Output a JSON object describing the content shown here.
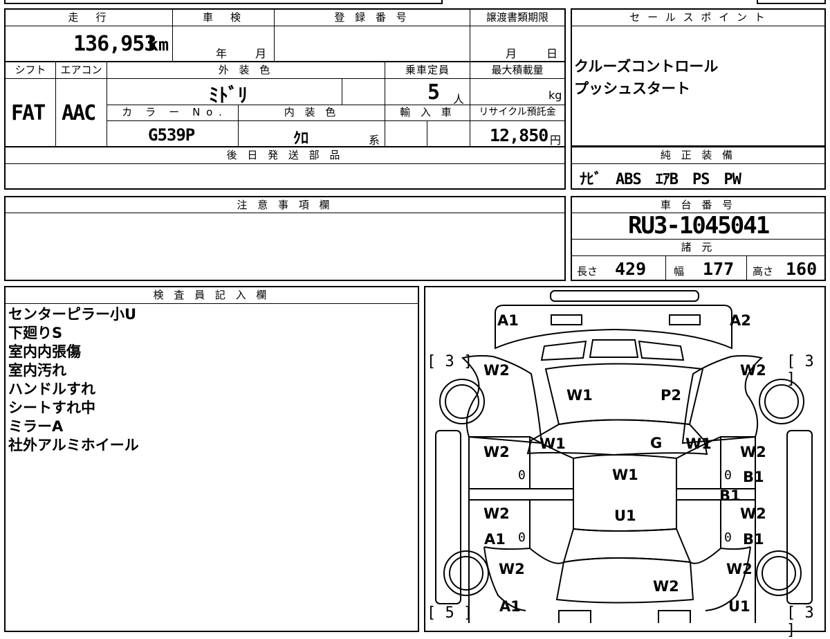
{
  "left_table": {
    "headers": {
      "mileage": "走　行",
      "inspection": "車　検",
      "registration_number": "登 録 番 号",
      "transfer_deadline": "譲渡書類期限",
      "shift": "シフト",
      "aircon": "エアコン",
      "exterior_color": "外 装 色",
      "capacity": "乗車定員",
      "max_load": "最大積載量",
      "color_no": "カ　ラ　ー　N o .",
      "interior_color": "内 装 色",
      "import": "輸 入 車",
      "recycle_fee": "リサイクル預託金",
      "later_parts": "後 日 発 送 部 品"
    },
    "values": {
      "mileage": "136,953",
      "mileage_unit": "km",
      "year_unit": "年",
      "month_unit": "月",
      "deadline_month": "月",
      "deadline_day": "日",
      "shift": "FAT",
      "aircon": "AAC",
      "exterior_color": "ﾐﾄﾞﾘ",
      "capacity": "5",
      "capacity_unit": "人",
      "max_load_unit": "kg",
      "color_no": "G539P",
      "interior_color": "ｸﾛ",
      "interior_suffix": "系",
      "recycle_fee": "12,850",
      "recycle_unit": "円"
    }
  },
  "sales_points": {
    "header": "セ ー ル ス ポ イ ン ト",
    "lines": [
      "クルーズコントロール",
      "プッシュスタート"
    ]
  },
  "genuine_equipment": {
    "header": "純 正 装 備",
    "value": "ﾅﾋﾞ　ABS　ｴｱB　PS　PW"
  },
  "notes": {
    "header": "注 意 事 項 欄"
  },
  "chassis": {
    "header": "車 台 番 号",
    "value": "RU3-1045041",
    "spec_header": "諸 元",
    "length_label": "長さ",
    "length": "429",
    "width_label": "幅",
    "width": "177",
    "height_label": "高さ",
    "height": "160"
  },
  "inspector": {
    "header": "検 査 員 記 入 欄",
    "lines": [
      "センターピラー小U",
      "下廻りS",
      "室内内張傷",
      "室内汚れ",
      "ハンドルすれ",
      "シートすれ中",
      "ミラーA",
      "社外アルミホイール"
    ]
  },
  "diagram": {
    "front_left": "A1",
    "front_right": "A2",
    "fl_bracket": "[ 3 ]",
    "fr_bracket": "[ 3 ]",
    "rl_bracket": "[ 5 ]",
    "rr_bracket": "[ 3 ]",
    "fender_fl": "W2",
    "fender_fr": "W2",
    "hood_left": "W1",
    "hood_right": "P2",
    "pillar_left": "W1",
    "pillar_right": "W1",
    "windshield": "G",
    "door_fl": "W2",
    "door_fl_mark": "0",
    "door_fr": "W2",
    "door_fr_mark": "0",
    "door_fr_b": "B1",
    "roof_top": "W1",
    "rocker_right": "B1",
    "door_rl": "W2",
    "door_rl_a": "A1",
    "door_rl_mark": "0",
    "door_rr": "W2",
    "door_rr_b": "B1",
    "door_rr_mark": "0",
    "roof_center": "U1",
    "quarter_rl": "W2",
    "quarter_rr": "W2",
    "trunk": "W2",
    "rear_left": "A1",
    "rear_right": "U1"
  }
}
